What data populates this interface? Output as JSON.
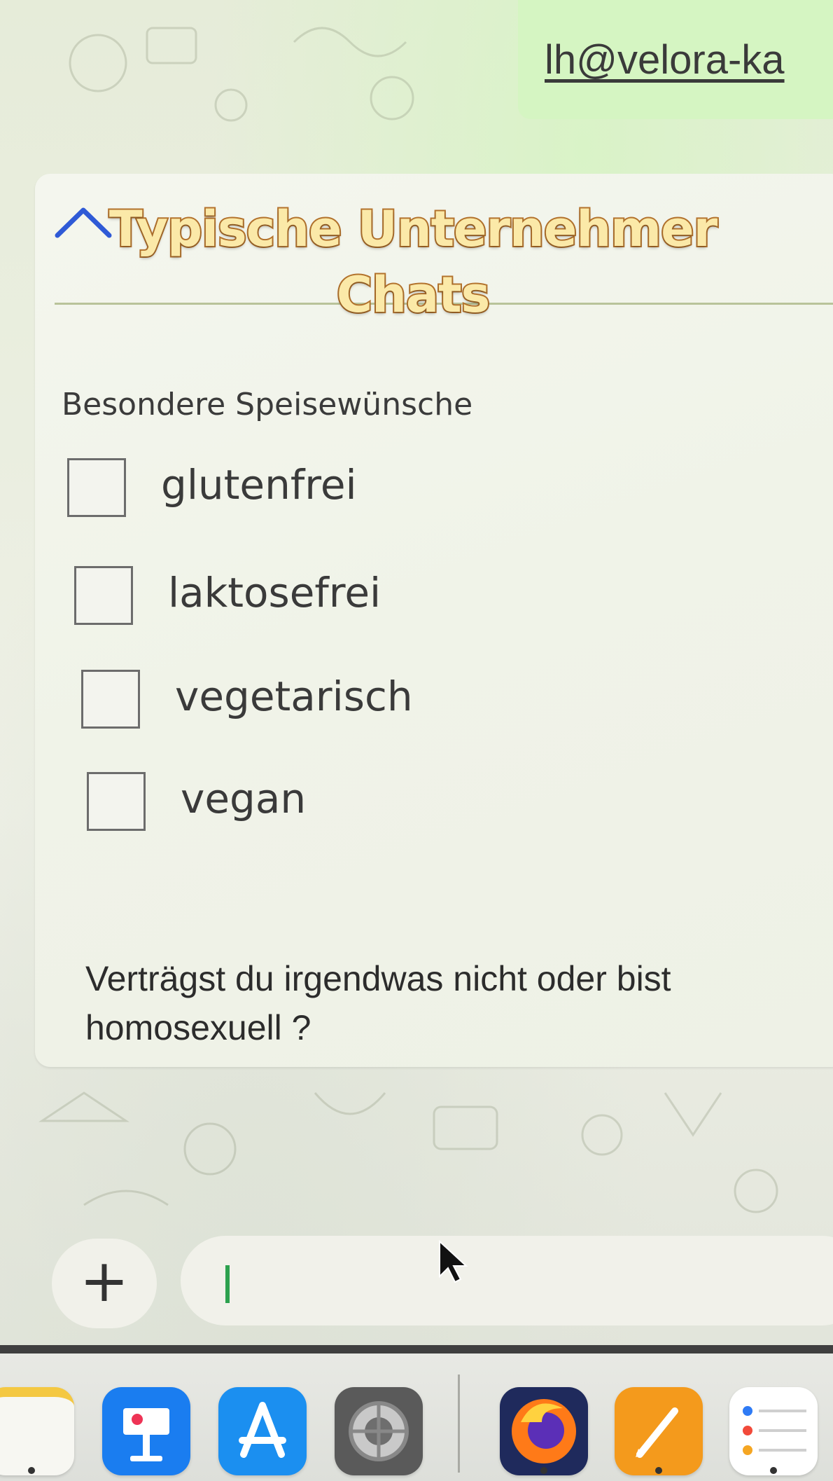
{
  "header": {
    "email": "lh@velora-ka"
  },
  "overlay": {
    "title": "Typische Unternehmer Chats"
  },
  "message": {
    "form_label": "Besondere Speisewünsche",
    "options": [
      {
        "label": "glutenfrei",
        "checked": false
      },
      {
        "label": "laktosefrei",
        "checked": false
      },
      {
        "label": "vegetarisch",
        "checked": false
      },
      {
        "label": "vegan",
        "checked": false
      }
    ],
    "text": "Verträgst du irgendwas nicht oder bist homosexuell ?"
  },
  "composer": {
    "plus_label": "+",
    "input_value": ""
  },
  "dock": {
    "apps": [
      {
        "name": "notes-icon",
        "color": "#f4c842"
      },
      {
        "name": "keynote-icon",
        "color": "#1a7df0"
      },
      {
        "name": "app-store-icon",
        "color": "#1b8ff0"
      },
      {
        "name": "system-settings-icon",
        "color": "#7b7b7b"
      },
      {
        "name": "firefox-icon",
        "color": "#ff7a18"
      },
      {
        "name": "pages-icon",
        "color": "#f49a1c"
      },
      {
        "name": "reminders-icon",
        "color": "#ffffff"
      }
    ]
  },
  "colors": {
    "accent_blue": "#2f5ad6",
    "overlay_fill": "#fbe9a8",
    "overlay_stroke": "#b4732d",
    "caret_green": "#2ca14e",
    "sent_bubble": "#d5f5c2"
  }
}
